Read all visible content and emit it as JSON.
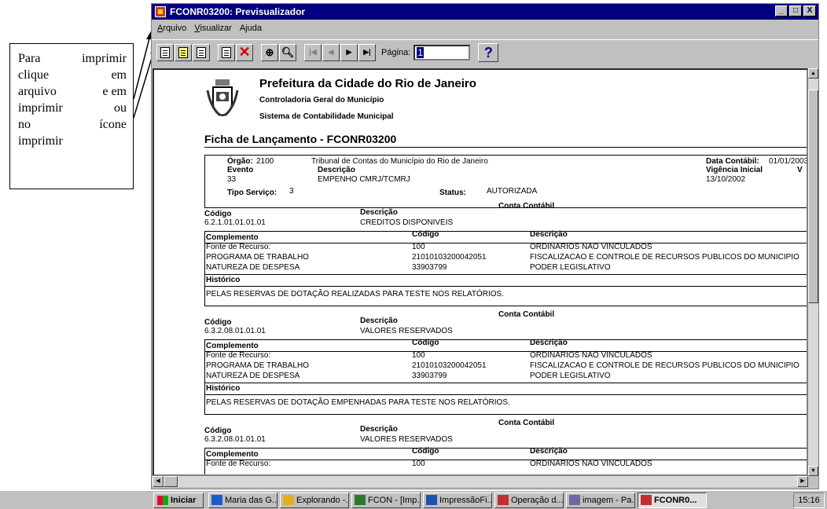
{
  "callout": {
    "lines": [
      [
        "Para",
        "imprimir"
      ],
      [
        "clique",
        "em"
      ],
      [
        "arquivo",
        "e em"
      ],
      [
        "imprimir",
        "ou"
      ],
      [
        "no",
        "ícone"
      ],
      [
        "imprimir",
        ""
      ]
    ]
  },
  "window": {
    "title": "FCONR03200: Previsualizador",
    "controls": [
      "_",
      "□",
      "X"
    ]
  },
  "menu": [
    {
      "label": "Arquivo",
      "accel": "A",
      "rest": "rquivo"
    },
    {
      "label": "Visualizar",
      "accel": "V",
      "rest": "isualizar"
    },
    {
      "label": "Ajuda",
      "accel": "j",
      "pre": "A",
      "rest": "uda"
    }
  ],
  "toolbar": {
    "page_label": "Página:",
    "page_value": "1",
    "help": "?"
  },
  "report": {
    "org_title": "Prefeitura da Cidade do Rio de Janeiro",
    "org_sub1": "Controladoria Geral do Município",
    "org_sub2": "Sistema de Contabilidade Municipal",
    "doc_title": "Ficha de Lançamento - FCONR03200",
    "orgao_label": "Órgão:",
    "orgao_value": "2100",
    "orgao_name": "Tribunal de Contas do Município do Rio de Janeiro",
    "data_contabil_label": "Data Contábil:",
    "data_contabil_value": "01/01/2003",
    "evento_label": "Evento",
    "evento_value": "33",
    "descricao_label": "Descrição",
    "evento_desc": "EMPENHO CMRJ/TCMRJ",
    "vigencia_label": "Vigência Inicial",
    "vigencia_value": "13/10/2002",
    "extra_col": "V",
    "tipo_servico_label": "Tipo Serviço:",
    "tipo_servico_value": "3",
    "status_label": "Status:",
    "status_value": "AUTORIZADA",
    "conta_contabil_label": "Conta Contábil",
    "codigo_label": "Código",
    "complemento_label": "Complemento",
    "historico_label": "Histórico",
    "blocks": [
      {
        "codigo": "6.2.1.01.01.01.01",
        "descricao": "CREDITOS DISPONIVEIS",
        "rows": [
          {
            "comp": "Fonte de Recurso:",
            "cod": "100",
            "desc": "ORDINARIOS NAO VINCULADOS"
          },
          {
            "comp": "PROGRAMA DE TRABALHO",
            "cod": "21010103200042051",
            "desc": "FISCALIZACAO E CONTROLE DE RECURSOS PUBLICOS DO MUNICIPIO"
          },
          {
            "comp": "NATUREZA DE DESPESA",
            "cod": "33903799",
            "desc": "PODER LEGISLATIVO"
          }
        ],
        "historico": "PELAS RESERVAS DE DOTAÇÃO REALIZADAS PARA TESTE NOS RELATÓRIOS."
      },
      {
        "codigo": "6.3.2.08.01.01.01",
        "descricao": "VALORES RESERVADOS",
        "rows": [
          {
            "comp": "Fonte de Recurso:",
            "cod": "100",
            "desc": "ORDINARIOS NAO VINCULADOS"
          },
          {
            "comp": "PROGRAMA DE TRABALHO",
            "cod": "21010103200042051",
            "desc": "FISCALIZACAO E CONTROLE DE RECURSOS PUBLICOS DO MUNICIPIO"
          },
          {
            "comp": "NATUREZA DE DESPESA",
            "cod": "33903799",
            "desc": "PODER LEGISLATIVO"
          }
        ],
        "historico": "PELAS RESERVAS DE DOTAÇÃO EMPENHADAS PARA TESTE NOS RELATÓRIOS."
      },
      {
        "codigo": "6.3.2.08.01.01.01",
        "descricao": "VALORES RESERVADOS",
        "rows": [
          {
            "comp": "Fonte de Recurso:",
            "cod": "100",
            "desc": "ORDINARIOS NAO VINCULADOS"
          }
        ]
      }
    ]
  },
  "taskbar": {
    "start": "Iniciar",
    "tasks": [
      {
        "label": "Maria das G...",
        "icon_color": "#1c5cc8"
      },
      {
        "label": "Explorando -...",
        "icon_color": "#e0b020"
      },
      {
        "label": "FCON - [Imp...",
        "icon_color": "#2a7a2a"
      },
      {
        "label": "ImpressãoFi...",
        "icon_color": "#2050b0"
      },
      {
        "label": "Operação d...",
        "icon_color": "#c03030"
      },
      {
        "label": "imagem - Pa...",
        "icon_color": "#6a6aa0"
      },
      {
        "label": "FCONR0...",
        "icon_color": "#c03030"
      }
    ],
    "clock": "15:16"
  }
}
